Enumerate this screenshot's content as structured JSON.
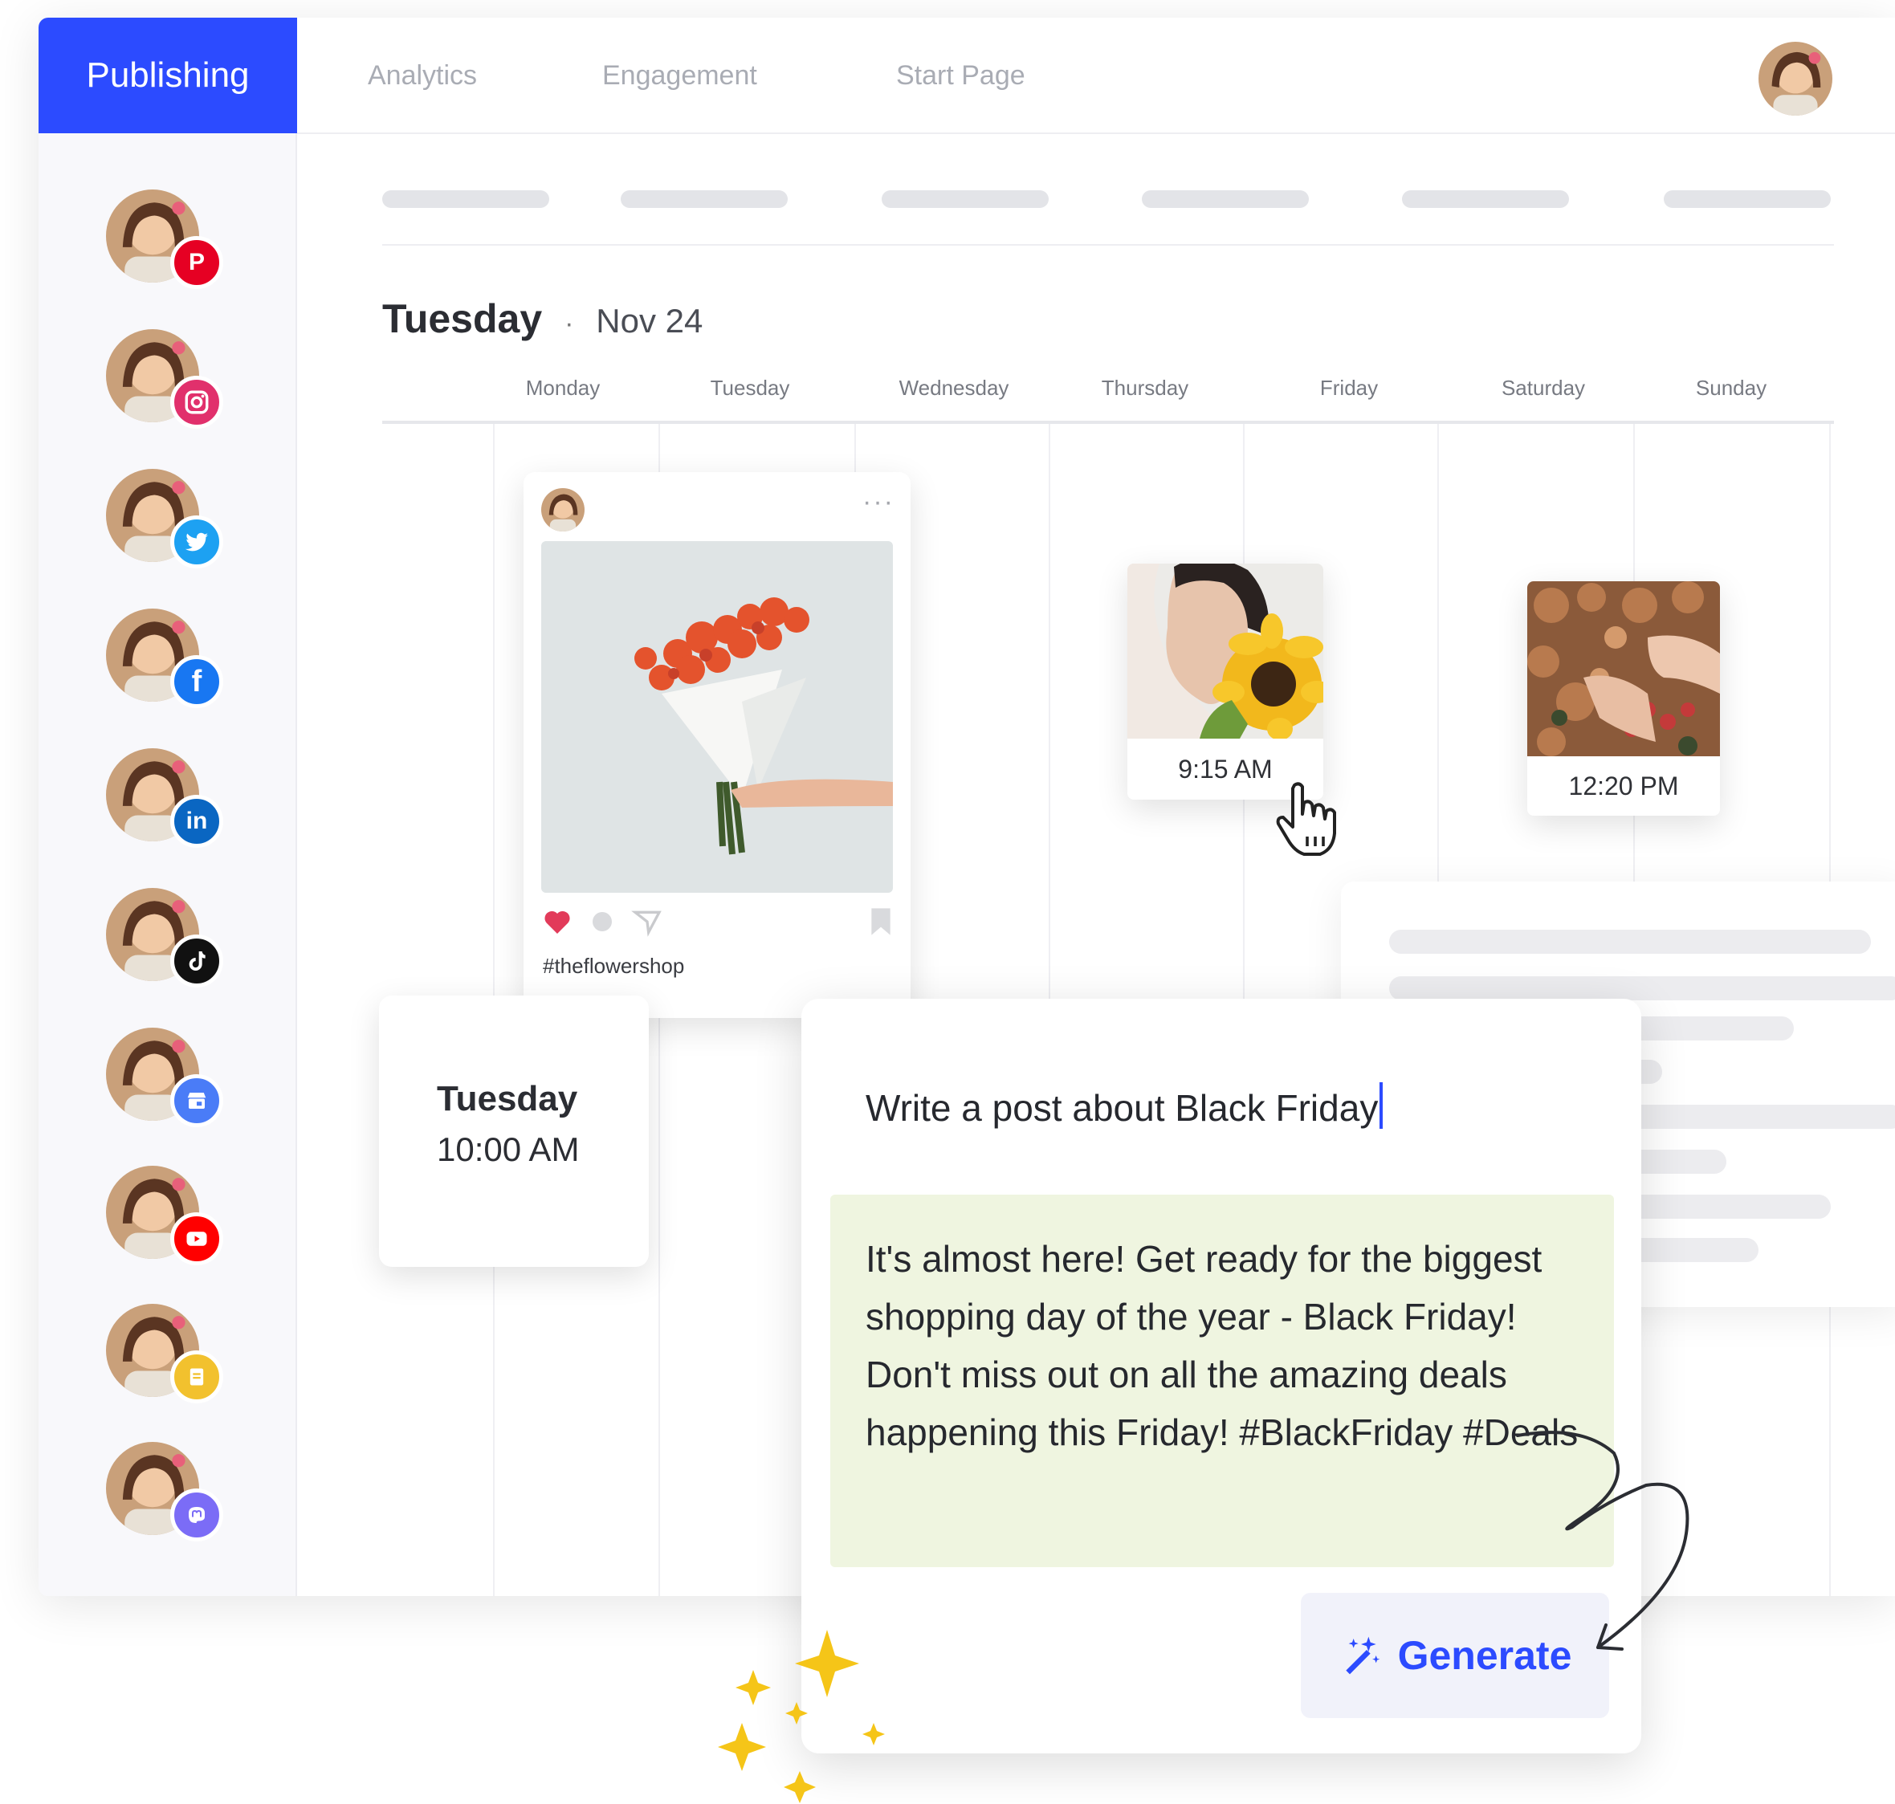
{
  "nav": {
    "tabs": [
      {
        "label": "Publishing",
        "active": true
      },
      {
        "label": "Analytics",
        "active": false
      },
      {
        "label": "Engagement",
        "active": false
      },
      {
        "label": "Start Page",
        "active": false
      }
    ]
  },
  "accounts": [
    {
      "network": "pinterest",
      "icon": "pinterest-icon",
      "color": "#e60023"
    },
    {
      "network": "instagram",
      "icon": "instagram-icon",
      "color": "#e1306c"
    },
    {
      "network": "twitter",
      "icon": "twitter-icon",
      "color": "#1da1f2"
    },
    {
      "network": "facebook",
      "icon": "facebook-icon",
      "color": "#1877f2"
    },
    {
      "network": "linkedin",
      "icon": "linkedin-icon",
      "color": "#0a66c2"
    },
    {
      "network": "tiktok",
      "icon": "tiktok-icon",
      "color": "#111111"
    },
    {
      "network": "google-business",
      "icon": "google-business-icon",
      "color": "#4a7cf7"
    },
    {
      "network": "youtube",
      "icon": "youtube-icon",
      "color": "#ff0000"
    },
    {
      "network": "startpage",
      "icon": "startpage-icon",
      "color": "#f2c12e"
    },
    {
      "network": "mastodon",
      "icon": "mastodon-icon",
      "color": "#7b6cf6"
    }
  ],
  "calendar": {
    "day": "Tuesday",
    "separator": "·",
    "date": "Nov 24",
    "weekdays": [
      "Monday",
      "Tuesday",
      "Wednesday",
      "Thursday",
      "Friday",
      "Saturday",
      "Sunday"
    ]
  },
  "post_preview": {
    "hashtag": "#theflowershop",
    "more": "···"
  },
  "scheduled": [
    {
      "time": "9:15 AM"
    },
    {
      "time": "12:20 PM"
    }
  ],
  "time_card": {
    "day": "Tuesday",
    "time": "10:00 AM"
  },
  "ai_assistant": {
    "prompt": "Write a post about Black Friday",
    "output": "It's almost here! Get ready for the biggest shopping day of the year - Black Friday! Don't miss out on all the amazing deals happening this Friday! #BlackFriday #Deals",
    "generate_label": "Generate"
  },
  "colors": {
    "accent": "#2c4bff",
    "output_bg": "#eff5e0",
    "generate_bg": "#f1f2fa",
    "sparkle": "#f5c518"
  }
}
